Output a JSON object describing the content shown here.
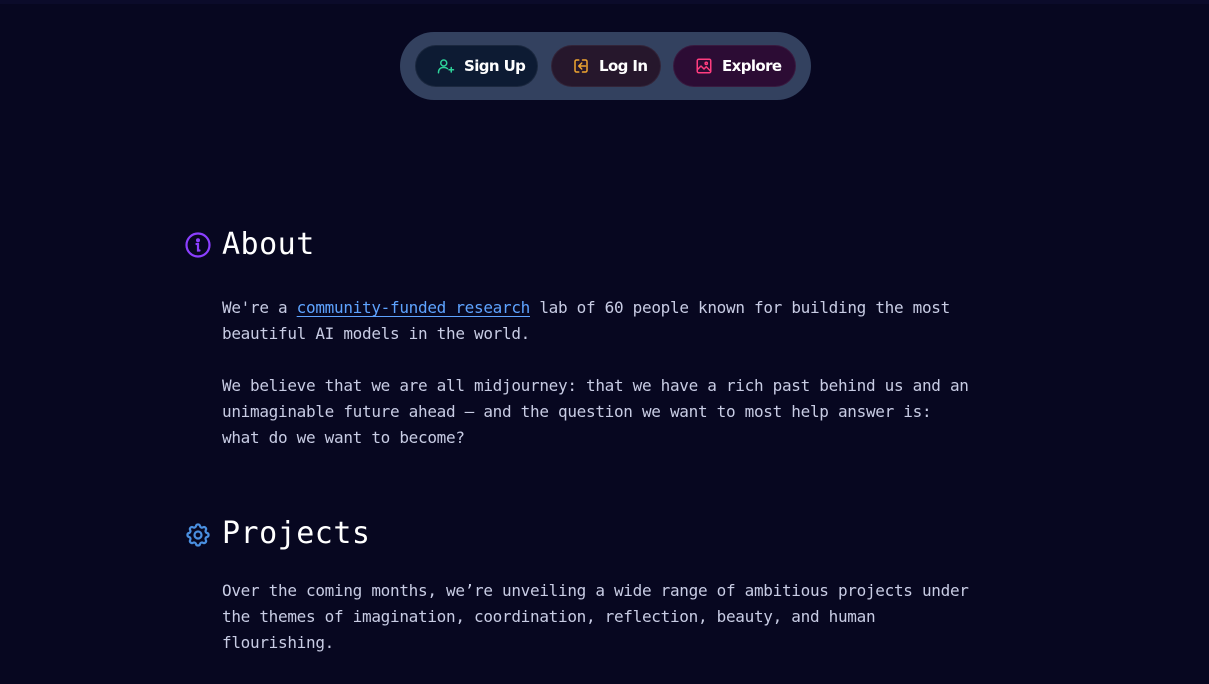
{
  "nav": {
    "signup_label": "Sign Up",
    "login_label": "Log In",
    "explore_label": "Explore",
    "signup_icon": "user-plus-icon",
    "login_icon": "login-icon",
    "explore_icon": "image-icon"
  },
  "colors": {
    "background": "#070720",
    "nav_pill": "#33415f",
    "signup_accent": "#2ed39a",
    "login_accent": "#f0a630",
    "explore_accent": "#ff3d7f",
    "about_icon": "#8b3fff",
    "projects_icon": "#4a8fe0",
    "link": "#5ea3ff"
  },
  "about": {
    "title": "About",
    "icon": "info-icon",
    "p1_before": "We're a ",
    "p1_link": "community-funded research",
    "p1_after": " lab of 60 people known for building the most\nbeautiful AI models in the world.",
    "p2": "We believe that we are all midjourney: that we have a rich past behind us and an\nunimaginable future ahead — and the question we want to most help answer is:\nwhat do we want to become?"
  },
  "projects": {
    "title": "Projects",
    "icon": "gear-icon",
    "p1": "Over the coming months, we’re unveiling a wide range of ambitious projects under\nthe themes of imagination, coordination, reflection, beauty, and human\nflourishing."
  }
}
